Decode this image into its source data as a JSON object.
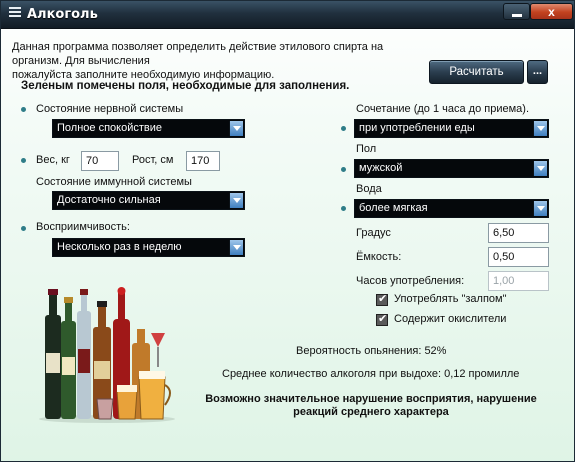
{
  "window": {
    "title": "Алкоголь"
  },
  "title_bar": {
    "close_glyph": "x"
  },
  "intro": {
    "line1": "Данная программа позволяет определить действие этилового спирта на организм. Для вычисления",
    "line2": "пожалуйста заполните необходимую информацию."
  },
  "required_note": "Зеленым помечены поля, необходимые для заполнения.",
  "buttons": {
    "calculate": "Расчитать",
    "more": "..."
  },
  "left": {
    "nervous": {
      "label": "Состояние нервной системы",
      "value": "Полное спокойствие"
    },
    "weight": {
      "label": "Вес, кг",
      "value": "70"
    },
    "height": {
      "label": "Рост, см",
      "value": "170"
    },
    "immune": {
      "label": "Состояние иммунной системы",
      "value": "Достаточно сильная"
    },
    "susceptibility": {
      "label": "Восприимчивость:",
      "value": "Несколько раз в неделю"
    }
  },
  "right": {
    "combination": {
      "label": "Сочетание (до 1 часа до приема).",
      "value": "при употреблении еды"
    },
    "gender": {
      "label": "Пол",
      "value": "мужской"
    },
    "water": {
      "label": "Вода",
      "value": "более мягкая"
    },
    "degree": {
      "label": "Градус",
      "value": "6,50"
    },
    "capacity": {
      "label": "Ёмкость:",
      "value": "0,50"
    },
    "hours": {
      "label": "Часов употребления:",
      "value": "1,00"
    },
    "gulp": {
      "label": "Употреблять \"залпом\"",
      "checked": true
    },
    "antioxidants": {
      "label": "Содержит окислители",
      "checked": true
    }
  },
  "results": {
    "probability": "Вероятность опьянения: 52%",
    "average": "Среднее количество алкоголя при выдохе: 0,12 промилле",
    "conclusion_line1": "Возможно значительное нарушение восприятия, нарушение",
    "conclusion_line2": "реакций среднего характера"
  },
  "colors": {
    "accent_bullet": "#2f7d88",
    "title_bar": "#20303e",
    "background_tint": "#dff4e6"
  }
}
